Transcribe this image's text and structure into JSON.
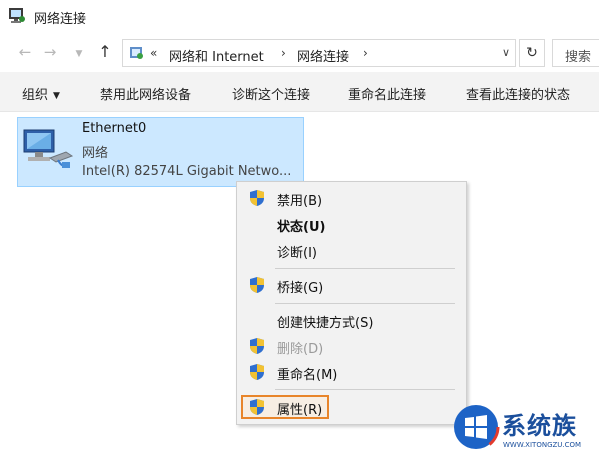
{
  "window": {
    "title": "网络连接"
  },
  "address": {
    "prefix": "«",
    "breadcrumbs": [
      {
        "label": "网络和 Internet"
      },
      {
        "label": "网络连接"
      }
    ],
    "separator": "›",
    "search_placeholder": "搜索"
  },
  "toolbar": {
    "organize": "组织",
    "disable": "禁用此网络设备",
    "diagnose": "诊断这个连接",
    "rename": "重命名此连接",
    "status": "查看此连接的状态"
  },
  "adapter": {
    "name": "Ethernet0",
    "status": "网络",
    "device": "Intel(R) 82574L Gigabit Netwo..."
  },
  "context_menu": {
    "items": [
      {
        "label": "禁用(B)"
      },
      {
        "label": "状态(U)"
      },
      {
        "label": "诊断(I)"
      },
      {
        "label": "桥接(G)"
      },
      {
        "label": "创建快捷方式(S)"
      },
      {
        "label": "删除(D)"
      },
      {
        "label": "重命名(M)"
      },
      {
        "label": "属性(R)"
      }
    ]
  },
  "watermark": {
    "text": "系统族",
    "url": "WWW.XITONGZU.COM"
  },
  "colors": {
    "selection_bg": "#cce8ff",
    "selection_border": "#99d1ff",
    "highlight_border": "#e8852a",
    "menu_bg": "#f2f2f2",
    "watermark_blue": "#1b4f9c"
  },
  "icons": {
    "shield": "uac-shield-icon",
    "network": "network-adapter-icon"
  }
}
